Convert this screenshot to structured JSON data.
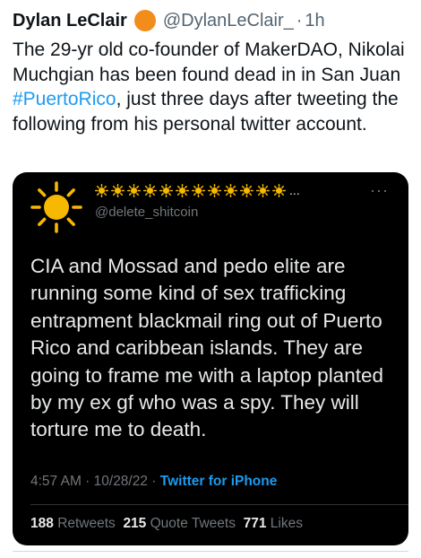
{
  "tweet": {
    "author_name": "Dylan LeClair",
    "author_handle": "@DylanLeClair_",
    "separator": "·",
    "time_ago": "1h",
    "text_before": "The 29-yr old co-founder of MakerDAO, Nikolai Muchgian has been found dead in in San Juan ",
    "hashtag": "#PuertoRico",
    "text_after": ", just three days after tweeting the following from his personal twitter account."
  },
  "quoted_tweet": {
    "handle": "@delete_shitcoin",
    "name_suffix": "...",
    "more": "···",
    "text": "CIA and Mossad and pedo elite are running some kind of sex trafficking entrapment blackmail ring out of Puerto Rico and caribbean islands. They are going to frame me with a laptop planted by my ex gf who was a spy. They will torture me to death.",
    "timestamp": "4:57 AM · 10/28/22 · ",
    "source": "Twitter for iPhone",
    "stats": {
      "retweets_count": "188",
      "retweets_label": "Retweets",
      "quotes_count": "215",
      "quotes_label": "Quote Tweets",
      "likes_count": "771",
      "likes_label": "Likes"
    }
  },
  "colors": {
    "link": "#1d9bf0",
    "badge": "#f28c1b",
    "quote_bg": "#000000"
  },
  "icons": {
    "author_badge": "orange-circle-icon",
    "quoted_avatar": "sun-icon",
    "quoted_name": "sun-emoji-icon"
  }
}
